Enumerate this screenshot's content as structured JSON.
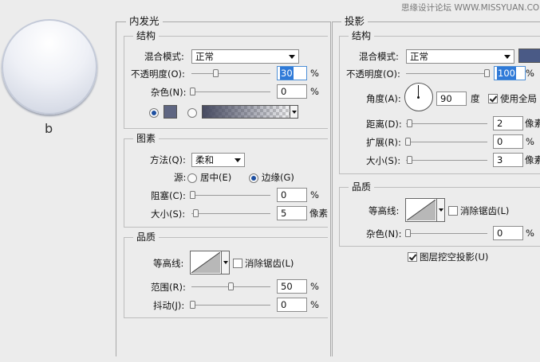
{
  "watermark": "思缘设计论坛 WWW.MISSYUAN.COM",
  "preview": {
    "label": "b"
  },
  "inner_glow": {
    "title": "内发光",
    "structure": {
      "title": "结构",
      "blend_mode_label": "混合模式:",
      "blend_mode_value": "正常",
      "opacity_label": "不透明度(O):",
      "opacity_value": "30",
      "noise_label": "杂色(N):",
      "noise_value": "0",
      "percent": "%",
      "color": "#5f6682"
    },
    "elements": {
      "title": "图素",
      "method_label": "方法(Q):",
      "method_value": "柔和",
      "source_label": "源:",
      "source_center": "居中(E)",
      "source_edge": "边缘(G)",
      "choke_label": "阻塞(C):",
      "choke_value": "0",
      "size_label": "大小(S):",
      "size_value": "5",
      "percent": "%",
      "px": "像素"
    },
    "quality": {
      "title": "品质",
      "contour_label": "等高线:",
      "anti_alias_label": "消除锯齿(L)",
      "range_label": "范围(R):",
      "range_value": "50",
      "jitter_label": "抖动(J):",
      "jitter_value": "0",
      "percent": "%"
    }
  },
  "drop_shadow": {
    "title": "投影",
    "structure": {
      "title": "结构",
      "blend_mode_label": "混合模式:",
      "blend_mode_value": "正常",
      "opacity_label": "不透明度(O):",
      "opacity_value": "100",
      "angle_label": "角度(A):",
      "angle_value": "90",
      "degree": "度",
      "global_light_label": "使用全局",
      "distance_label": "距离(D):",
      "distance_value": "2",
      "spread_label": "扩展(R):",
      "spread_value": "0",
      "size_label": "大小(S):",
      "size_value": "3",
      "percent": "%",
      "px": "像素",
      "color": "#4a5a86"
    },
    "quality": {
      "title": "品质",
      "contour_label": "等高线:",
      "anti_alias_label": "消除锯齿(L)",
      "noise_label": "杂色(N):",
      "noise_value": "0",
      "percent": "%"
    },
    "knockout_label": "图层挖空投影(U)"
  }
}
